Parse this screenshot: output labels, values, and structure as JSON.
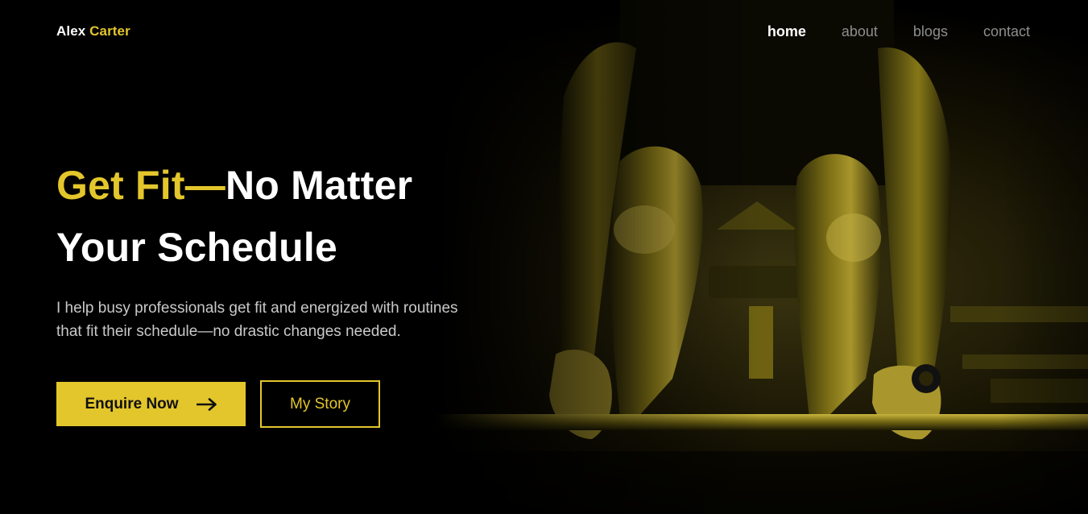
{
  "brand": {
    "first_name": "Alex",
    "last_name": "Carter"
  },
  "nav": {
    "items": [
      {
        "label": "home",
        "active": true
      },
      {
        "label": "about",
        "active": false
      },
      {
        "label": "blogs",
        "active": false
      },
      {
        "label": "contact",
        "active": false
      }
    ]
  },
  "hero": {
    "title_highlight": "Get Fit—",
    "title_rest_line1": "No Matter",
    "title_line2": "Your Schedule",
    "subtitle_line1": "I help busy professionals get fit and energized with routines",
    "subtitle_line2": "that fit their schedule—no drastic changes needed.",
    "primary_cta": "Enquire Now",
    "primary_cta_icon": "arrow-right-icon",
    "secondary_cta": "My Story",
    "background_image": "athlete-deadlift-photo"
  },
  "colors": {
    "accent": "#e3c62c",
    "background": "#000000",
    "text": "#ffffff",
    "muted_nav": "#8e8e8e",
    "subtitle": "#c9c9c9"
  }
}
